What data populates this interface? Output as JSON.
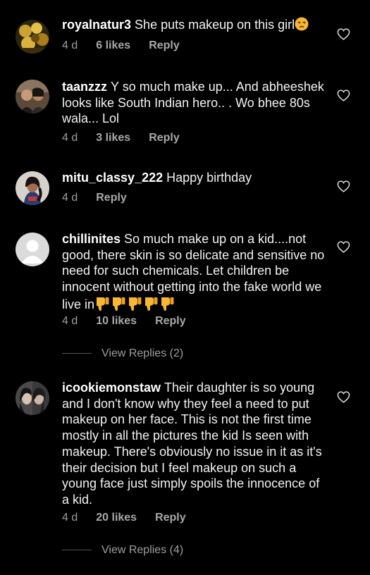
{
  "comments": [
    {
      "username": "royalnatur3",
      "text": "She puts makeup on this girl",
      "emoji": "unamused-face-emoji",
      "time": "4 d",
      "likes": "6 likes",
      "reply": "Reply"
    },
    {
      "username": "taanzzz",
      "text": "Y so much make up... And abheeshek looks like South Indian hero.. . Wo bhee 80s wala... Lol",
      "time": "4 d",
      "likes": "3 likes",
      "reply": "Reply"
    },
    {
      "username": "mitu_classy_222",
      "text": "Happy birthday",
      "time": "4 d",
      "reply": "Reply"
    },
    {
      "username": "chillinites",
      "text": "So much make up on a kid....not good, there skin is so delicate and sensitive no need for such chemicals. Let children be innocent without getting into the fake world we live in",
      "emoji": "thumbs-down-emoji x5",
      "time": "4 d",
      "likes": "10 likes",
      "reply": "Reply",
      "view_replies": "View Replies (2)"
    },
    {
      "username": "icookiemonstaw",
      "text": "Their daughter is so young and I don't know why they feel a need to put makeup on her face. This is not the first time mostly in all the pictures the kid Is seen with makeup. There's obviously no issue in it as it's their decision but I feel makeup on such a young face just simply spoils the innocence of a kid.",
      "time": "4 d",
      "likes": "20 likes",
      "reply": "Reply",
      "view_replies": "View Replies (4)"
    }
  ],
  "colors": {
    "background": "#000000",
    "text": "#f2f2f2",
    "secondary": "#9e9e9e",
    "emoji": "#f7b733"
  }
}
